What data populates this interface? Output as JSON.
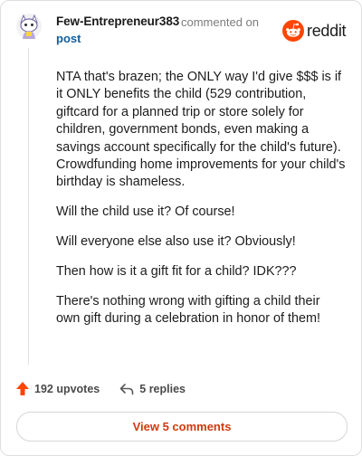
{
  "comment": {
    "author": "Few-Entrepreneur383",
    "action_text": "commented on",
    "post_link": "post",
    "body": [
      "NTA that's brazen; the ONLY way I'd give $$$ is if it ONLY benefits the child (529 contribution, giftcard for a planned trip or store solely for children, government bonds, even making a savings account specifically for the child's future). Crowdfunding home improvements for your child's birthday is shameless.",
      "Will the child use it? Of course!",
      "Will everyone else also use it? Obviously!",
      "Then how is it a gift fit for a child? IDK???",
      "There's nothing wrong with gifting a child their own gift during a celebration in honor of them!"
    ]
  },
  "brand": {
    "name": "reddit",
    "color": "#ff4500"
  },
  "footer": {
    "upvotes_label": "192 upvotes",
    "replies_label": "5 replies",
    "view_comments_label": "View 5 comments"
  },
  "icons": {
    "upvote": "upvote-arrow-icon",
    "reply": "reply-arrow-icon",
    "logo": "reddit-snoo-icon",
    "avatar": "user-avatar"
  },
  "colors": {
    "link": "#0f5e9c",
    "accent": "#cf3a0f",
    "upvote": "#ff4500"
  }
}
